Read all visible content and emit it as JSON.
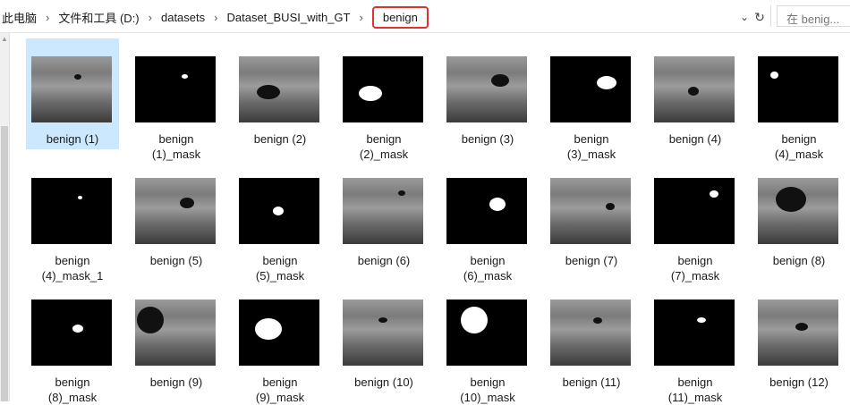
{
  "address_bar": {
    "breadcrumbs": [
      "此电脑",
      "文件和工具 (D:)",
      "datasets",
      "Dataset_BUSI_with_GT",
      "benign"
    ],
    "dropdown_icon": "chevron-down-icon",
    "refresh_icon": "refresh-icon"
  },
  "search": {
    "placeholder": "在 benig..."
  },
  "files": [
    {
      "line1": "benign (1)",
      "line2": "",
      "kind": "ultrasound",
      "selected": true
    },
    {
      "line1": "benign",
      "line2": "(1)_mask",
      "kind": "mask",
      "selected": false
    },
    {
      "line1": "benign (2)",
      "line2": "",
      "kind": "ultrasound",
      "selected": false
    },
    {
      "line1": "benign",
      "line2": "(2)_mask",
      "kind": "mask",
      "selected": false
    },
    {
      "line1": "benign (3)",
      "line2": "",
      "kind": "ultrasound",
      "selected": false
    },
    {
      "line1": "benign",
      "line2": "(3)_mask",
      "kind": "mask",
      "selected": false
    },
    {
      "line1": "benign (4)",
      "line2": "",
      "kind": "ultrasound",
      "selected": false
    },
    {
      "line1": "benign",
      "line2": "(4)_mask",
      "kind": "mask",
      "selected": false
    },
    {
      "line1": "benign",
      "line2": "(4)_mask_1",
      "kind": "mask",
      "selected": false
    },
    {
      "line1": "benign (5)",
      "line2": "",
      "kind": "ultrasound",
      "selected": false
    },
    {
      "line1": "benign",
      "line2": "(5)_mask",
      "kind": "mask",
      "selected": false
    },
    {
      "line1": "benign (6)",
      "line2": "",
      "kind": "ultrasound",
      "selected": false
    },
    {
      "line1": "benign",
      "line2": "(6)_mask",
      "kind": "mask",
      "selected": false
    },
    {
      "line1": "benign (7)",
      "line2": "",
      "kind": "ultrasound",
      "selected": false
    },
    {
      "line1": "benign",
      "line2": "(7)_mask",
      "kind": "mask",
      "selected": false
    },
    {
      "line1": "benign (8)",
      "line2": "",
      "kind": "ultrasound",
      "selected": false
    },
    {
      "line1": "benign",
      "line2": "(8)_mask",
      "kind": "mask",
      "selected": false
    },
    {
      "line1": "benign (9)",
      "line2": "",
      "kind": "ultrasound",
      "selected": false
    },
    {
      "line1": "benign",
      "line2": "(9)_mask",
      "kind": "mask",
      "selected": false
    },
    {
      "line1": "benign (10)",
      "line2": "",
      "kind": "ultrasound",
      "selected": false
    },
    {
      "line1": "benign",
      "line2": "(10)_mask",
      "kind": "mask",
      "selected": false
    },
    {
      "line1": "benign (11)",
      "line2": "",
      "kind": "ultrasound",
      "selected": false
    },
    {
      "line1": "benign",
      "line2": "(11)_mask",
      "kind": "mask",
      "selected": false
    },
    {
      "line1": "benign (12)",
      "line2": "",
      "kind": "ultrasound",
      "selected": false
    }
  ],
  "colors": {
    "selection": "#cce8ff",
    "highlight_box": "#e03030",
    "mask_bg": "#000000",
    "mask_fg": "#ffffff"
  }
}
